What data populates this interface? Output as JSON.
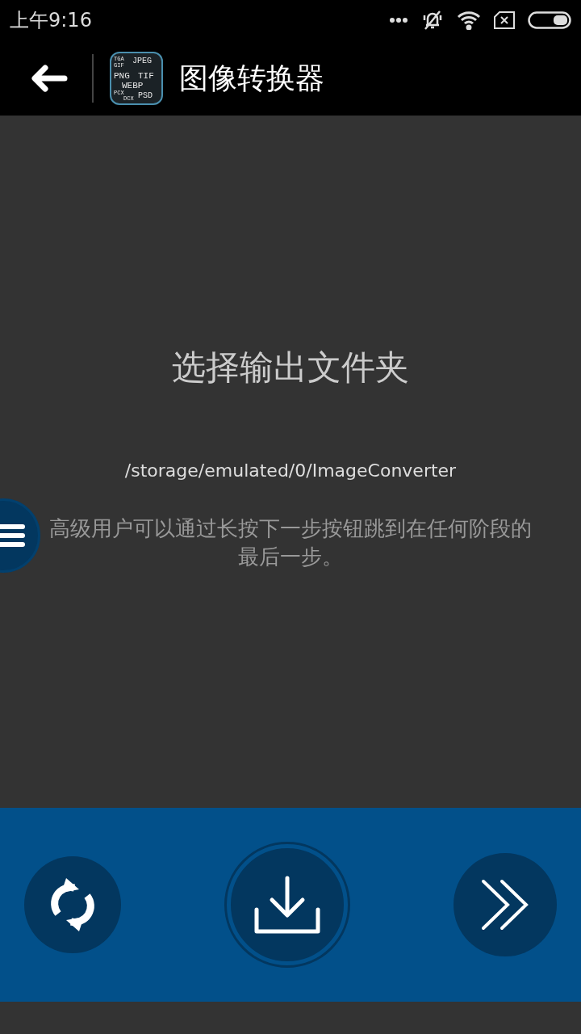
{
  "status_bar": {
    "time": "上午9:16"
  },
  "app_bar": {
    "title": "图像转换器",
    "app_icon_labels": [
      "TGA",
      "GIF",
      "JPEG",
      "PNG",
      "TIF",
      "WEBP",
      "PCX",
      "DCX",
      "PSD"
    ]
  },
  "content": {
    "heading": "选择输出文件夹",
    "path": "/storage/emulated/0/ImageConverter",
    "hint": "高级用户可以通过长按下一步按钮跳到在任何阶段的最后一步。"
  },
  "bottom_bar": {
    "buttons": [
      {
        "kind": "refresh"
      },
      {
        "kind": "download"
      },
      {
        "kind": "next"
      }
    ]
  }
}
